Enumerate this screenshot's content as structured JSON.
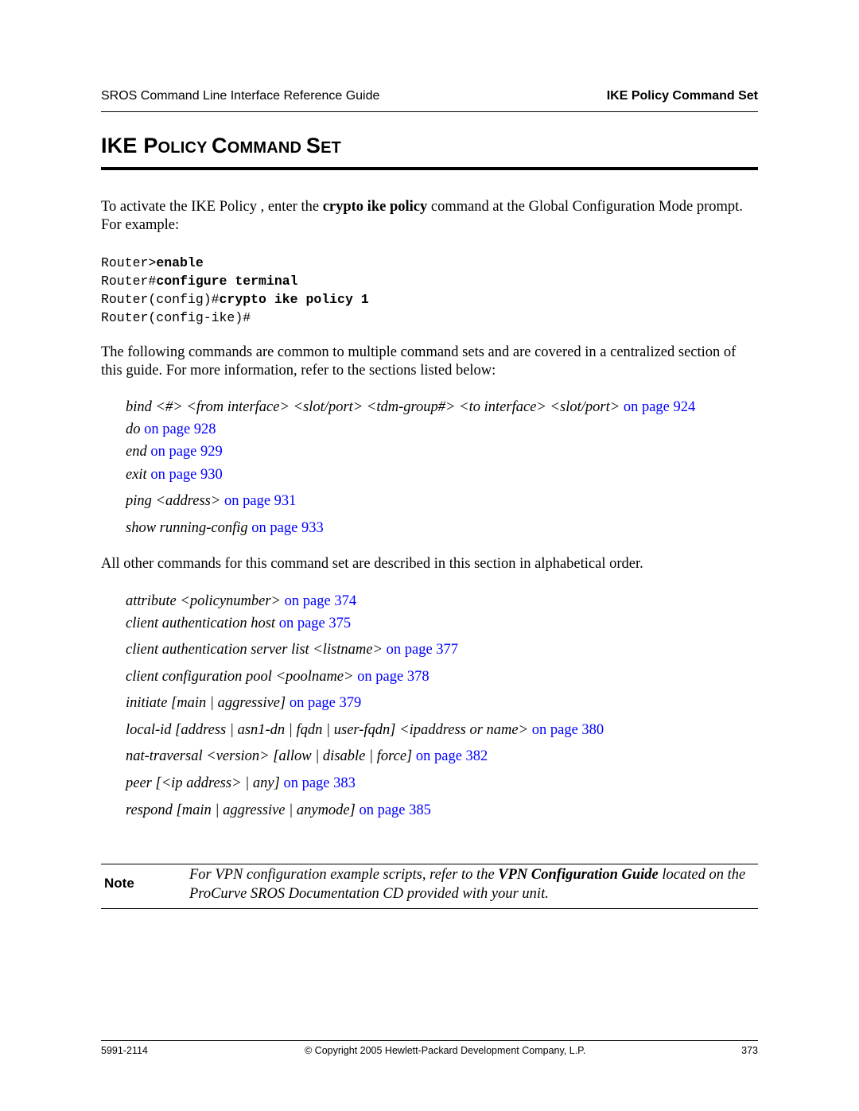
{
  "header": {
    "guide_title": "SROS Command Line Interface Reference Guide",
    "section_name": "IKE Policy Command Set"
  },
  "title": {
    "parts": [
      {
        "cap": "IKE ",
        "rest": ""
      },
      {
        "cap": "P",
        "rest": "OLICY "
      },
      {
        "cap": "C",
        "rest": "OMMAND "
      },
      {
        "cap": "S",
        "rest": "ET"
      }
    ]
  },
  "intro": {
    "before": "To activate the IKE Policy , enter the ",
    "command": "crypto ike policy",
    "after": " command at the Global Configuration Mode prompt. For example:"
  },
  "cli": [
    {
      "prompt": "Router>",
      "input": "enable"
    },
    {
      "prompt": "Router#",
      "input": "configure terminal"
    },
    {
      "prompt": "Router(config)#",
      "input": "crypto ike policy 1"
    },
    {
      "prompt": "Router(config-ike)#",
      "input": ""
    }
  ],
  "common_intro": "The following commands are common to multiple command sets and are covered in a centralized section of this guide. For more information, refer to the sections listed below:",
  "common_commands": [
    {
      "text": "bind <#> <from interface> <slot/port> <tdm-group#> <to interface> <slot/port>",
      "link": "on page 924"
    },
    {
      "text": "do",
      "link": "on page 928"
    },
    {
      "text": "end",
      "link": "on page 929"
    },
    {
      "text": "exit",
      "link": "on page 930"
    },
    {
      "text": "ping <address>",
      "link": "on page 931"
    },
    {
      "text": "show running-config",
      "link": "on page 933"
    }
  ],
  "other_intro": "All other commands for this command set are described in this section in alphabetical order.",
  "other_commands": [
    {
      "text": "attribute <policynumber>",
      "link": "on page 374"
    },
    {
      "text": "client authentication host",
      "link": "on page 375"
    },
    {
      "text": "client authentication server list <listname>",
      "link": "on page 377"
    },
    {
      "text": "client configuration pool <poolname>",
      "link": "on page 378"
    },
    {
      "text": "initiate [main | aggressive]",
      "link": "on page 379"
    },
    {
      "text": "local-id [address | asn1-dn | fqdn | user-fqdn] <ipaddress or name>",
      "link": "on page 380"
    },
    {
      "text": "nat-traversal <version> [allow | disable | force]",
      "link": "on page 382"
    },
    {
      "text": "peer [<ip address> | any]",
      "link": "on page 383"
    },
    {
      "text": "respond [main | aggressive | anymode]",
      "link": "on page 385"
    }
  ],
  "note": {
    "label": "Note",
    "before": "For VPN configuration example scripts, refer to the ",
    "bold": "VPN Configuration Guide",
    "after": " located on the ProCurve SROS Documentation CD provided with your unit."
  },
  "footer": {
    "doc_number": "5991-2114",
    "copyright": "© Copyright 2005 Hewlett-Packard Development Company, L.P.",
    "page_number": "373"
  },
  "colors": {
    "link": "#0000ff",
    "text": "#000000"
  }
}
